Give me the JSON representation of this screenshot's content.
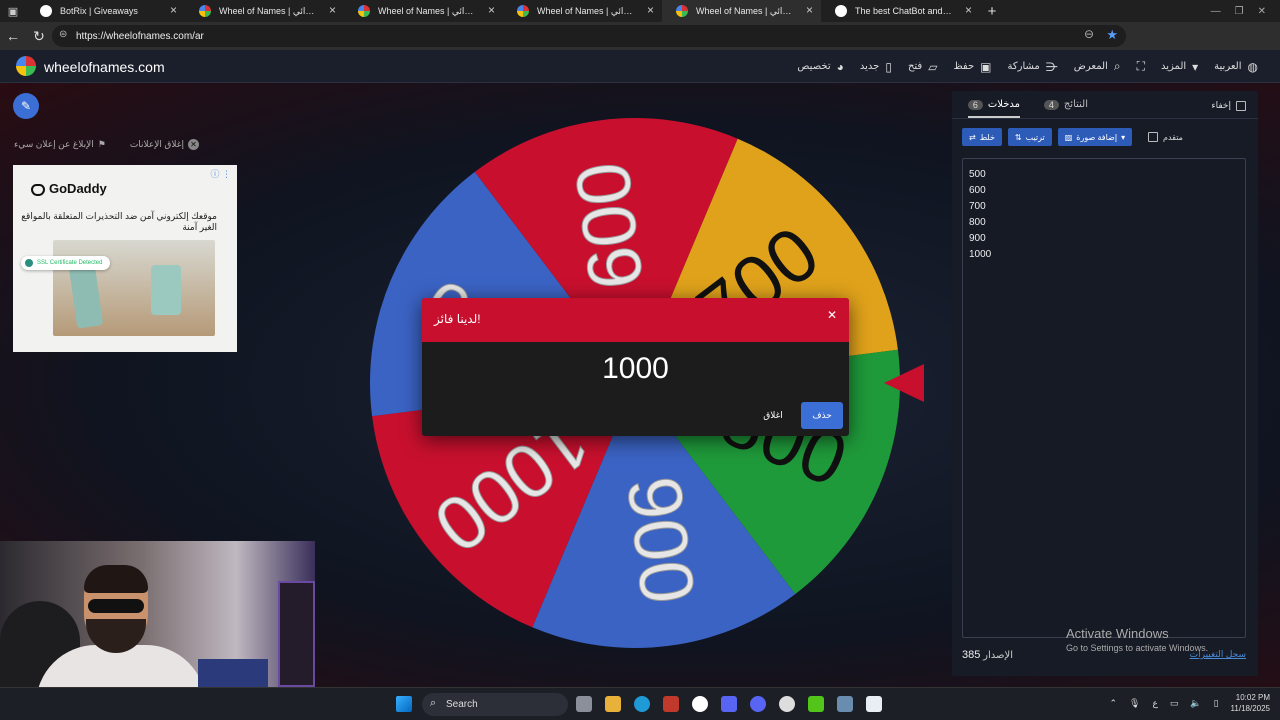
{
  "browser": {
    "tabs": [
      {
        "title": "BotRix | Giveaways",
        "active": false
      },
      {
        "title": "Wheel of Names | الاسم العشوائي",
        "active": false
      },
      {
        "title": "Wheel of Names | الاسم العشوائي",
        "active": false
      },
      {
        "title": "Wheel of Names | الاسم العشوائي",
        "active": false
      },
      {
        "title": "Wheel of Names | الاسم العشوائي",
        "active": true
      },
      {
        "title": "The best ChatBot and Widgets fo",
        "active": false
      }
    ],
    "url": "https://wheelofnames.com/ar"
  },
  "app": {
    "logo_text": "wheelofnames.com",
    "menu": [
      {
        "label": "العربية",
        "icon": "globe-icon"
      },
      {
        "label": "المزيد",
        "icon": "chevron-down-icon"
      },
      {
        "label": "",
        "icon": "fullscreen-icon"
      },
      {
        "label": "المعرض",
        "icon": "search-icon"
      },
      {
        "label": "مشاركة",
        "icon": "share-icon"
      },
      {
        "label": "حفظ",
        "icon": "save-icon"
      },
      {
        "label": "فتح",
        "icon": "folder-icon"
      },
      {
        "label": "جديد",
        "icon": "new-file-icon"
      },
      {
        "label": "تخصيص",
        "icon": "palette-icon"
      }
    ]
  },
  "ads": {
    "close_ads": "إغلاق الإعلانات",
    "report_ad": "الإبلاغ عن إعلان سيء",
    "brand": "GoDaddy",
    "text": "موقعك إلكتروني آمن ضد التحذيرات المتعلقة بالمواقع الغير آمنة",
    "badge": "SSL Certificate Detected"
  },
  "wheel": {
    "segments": [
      {
        "label": "500",
        "color": "#3b63c4"
      },
      {
        "label": "600",
        "color": "#c8102e"
      },
      {
        "label": "700",
        "color": "#e0a21b"
      },
      {
        "label": "800",
        "color": "#1f9a3a"
      },
      {
        "label": "900",
        "color": "#3b63c4"
      },
      {
        "label": "1000",
        "color": "#c8102e"
      }
    ]
  },
  "panel": {
    "entries_tab": "مدخلات",
    "entries_count": "6",
    "results_tab": "النتائج",
    "results_count": "4",
    "hide_label": "إخفاء",
    "shuffle": "خلط",
    "sort": "ترتيب",
    "add_image": "إضافة صورة",
    "advanced": "متقدم",
    "entries": [
      "500",
      "600",
      "700",
      "800",
      "900",
      "1000"
    ],
    "version_label": "الإصدار",
    "version": "385",
    "changelog": "سجل التغييرات"
  },
  "modal": {
    "title": "لدينا فائز!",
    "winner": "1000",
    "remove_btn": "حذف",
    "close_btn": "اغلاق"
  },
  "watermark": {
    "line1": "Activate Windows",
    "line2": "Go to Settings to activate Windows."
  },
  "taskbar": {
    "search": "Search",
    "time": "10:02 PM",
    "date": "11/18/2025",
    "lang": "ع"
  }
}
